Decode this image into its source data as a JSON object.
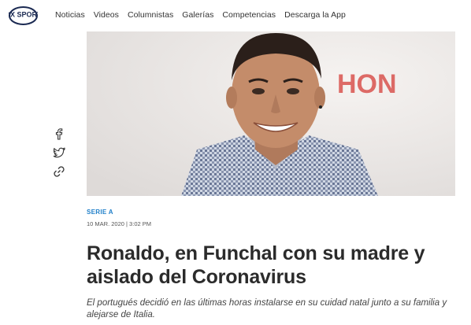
{
  "header": {
    "logo_text": "FOX SPORTS",
    "nav": [
      "Noticias",
      "Videos",
      "Columnistas",
      "Galerías",
      "Competencias",
      "Descarga la App"
    ]
  },
  "hero": {
    "background_text": "HON"
  },
  "share": {
    "icons": [
      "facebook-icon",
      "twitter-icon",
      "link-icon"
    ]
  },
  "article": {
    "section": "SERIE A",
    "date": "10 MAR. 2020 | 3:02 PM",
    "title": "Ronaldo, en Funchal con su madre y aislado del Coronavirus",
    "subtitle": "El portugués decidió en las últimas horas instalarse en su cuidad natal junto a su familia y alejarse de Italia."
  },
  "colors": {
    "accent": "#1f7fc9",
    "title": "#2b2b2b",
    "logo": "#1b2a52"
  }
}
